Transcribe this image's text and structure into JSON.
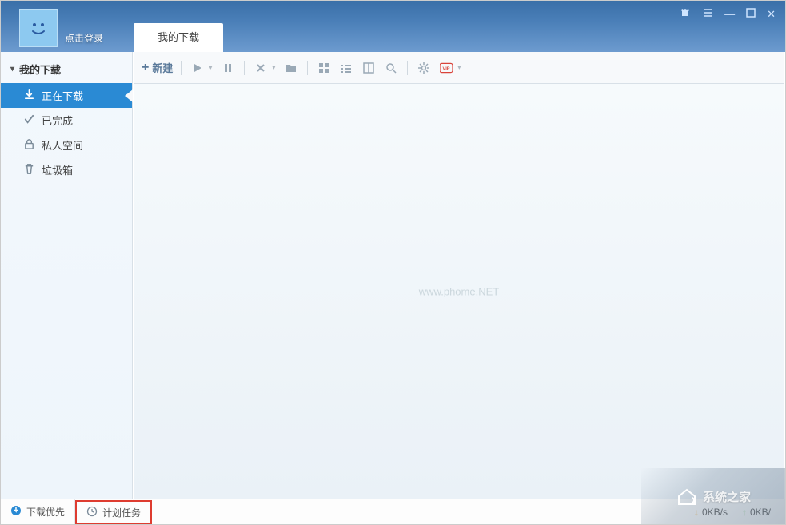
{
  "header": {
    "login_label": "点击登录",
    "tab_label": "我的下载"
  },
  "toolbar": {
    "new_label": "新建"
  },
  "sidebar": {
    "header": "我的下载",
    "items": [
      {
        "label": "正在下载"
      },
      {
        "label": "已完成"
      },
      {
        "label": "私人空间"
      },
      {
        "label": "垃圾箱"
      }
    ]
  },
  "main": {
    "watermark": "www.phome.NET"
  },
  "status": {
    "priority_label": "下载优先",
    "schedule_label": "计划任务",
    "down_speed": "0KB/s",
    "up_speed": "0KB/"
  },
  "overlay": {
    "site_text": "系统之家"
  }
}
